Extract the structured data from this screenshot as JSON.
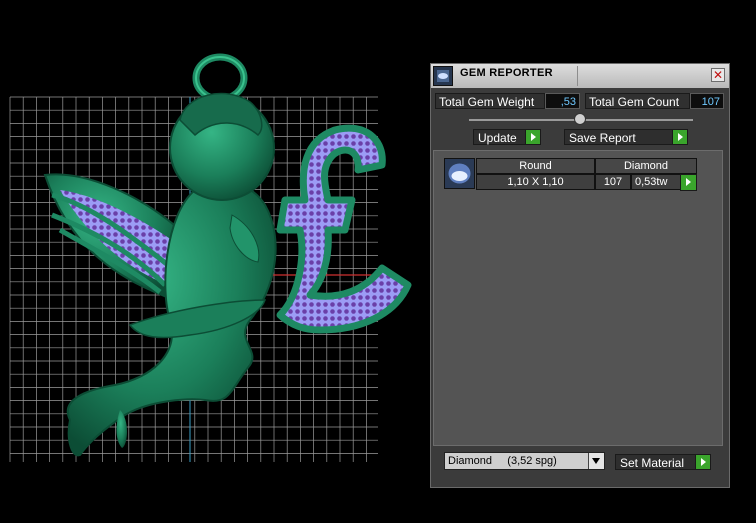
{
  "panel": {
    "title": "GEM REPORTER",
    "close_glyph": "✕",
    "total_weight_label": "Total Gem Weight",
    "total_weight_value": ",53",
    "total_count_label": "Total Gem Count",
    "total_count_value": "107",
    "update_label": "Update",
    "save_report_label": "Save Report",
    "table": {
      "headers": [
        "Round",
        "Diamond"
      ],
      "row": {
        "size": "1,10 X 1,10",
        "count": "107",
        "weight": "0,53tw"
      }
    },
    "material_select": "Diamond     (3,52 spg)",
    "set_material_label": "Set Material"
  },
  "icons": {
    "title_icon": "gem-reporter-icon",
    "close": "close-icon",
    "go": "play-arrow-icon",
    "dropdown": "chevron-down-icon",
    "gem_thumb": "round-diamond-icon"
  },
  "colors": {
    "model": "#1e8a63",
    "gems": "#8f8ff0",
    "grid": "#9c9c9c",
    "accent_green": "#3aa52c",
    "value_blue": "#6fc9ff"
  }
}
